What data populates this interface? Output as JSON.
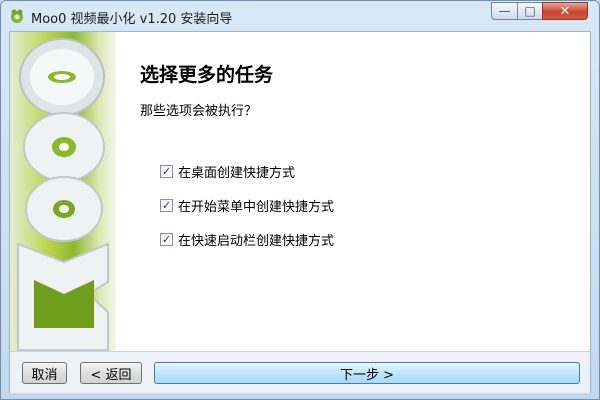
{
  "window": {
    "title": "Moo0 视频最小化 v1.20 安装向导",
    "controls": {
      "minimize": "▭",
      "maximize": "▢",
      "close": "✕"
    }
  },
  "banner": {
    "logo_text": "Moo0"
  },
  "page": {
    "heading": "选择更多的任务",
    "subtitle": "那些选项会被执行？",
    "options": [
      {
        "label": "在桌面创建快捷方式",
        "checked": true
      },
      {
        "label": "在开始菜单中创建快捷方式",
        "checked": true
      },
      {
        "label": "在快速启动栏创建快捷方式",
        "checked": true
      }
    ],
    "check_glyph": "✓"
  },
  "buttons": {
    "cancel": "取消",
    "back": "< 返回",
    "next": "下一步 >"
  },
  "colors": {
    "banner_green": "#8db82a",
    "accent_blue": "#3c7fb1",
    "close_red": "#c8452f"
  }
}
